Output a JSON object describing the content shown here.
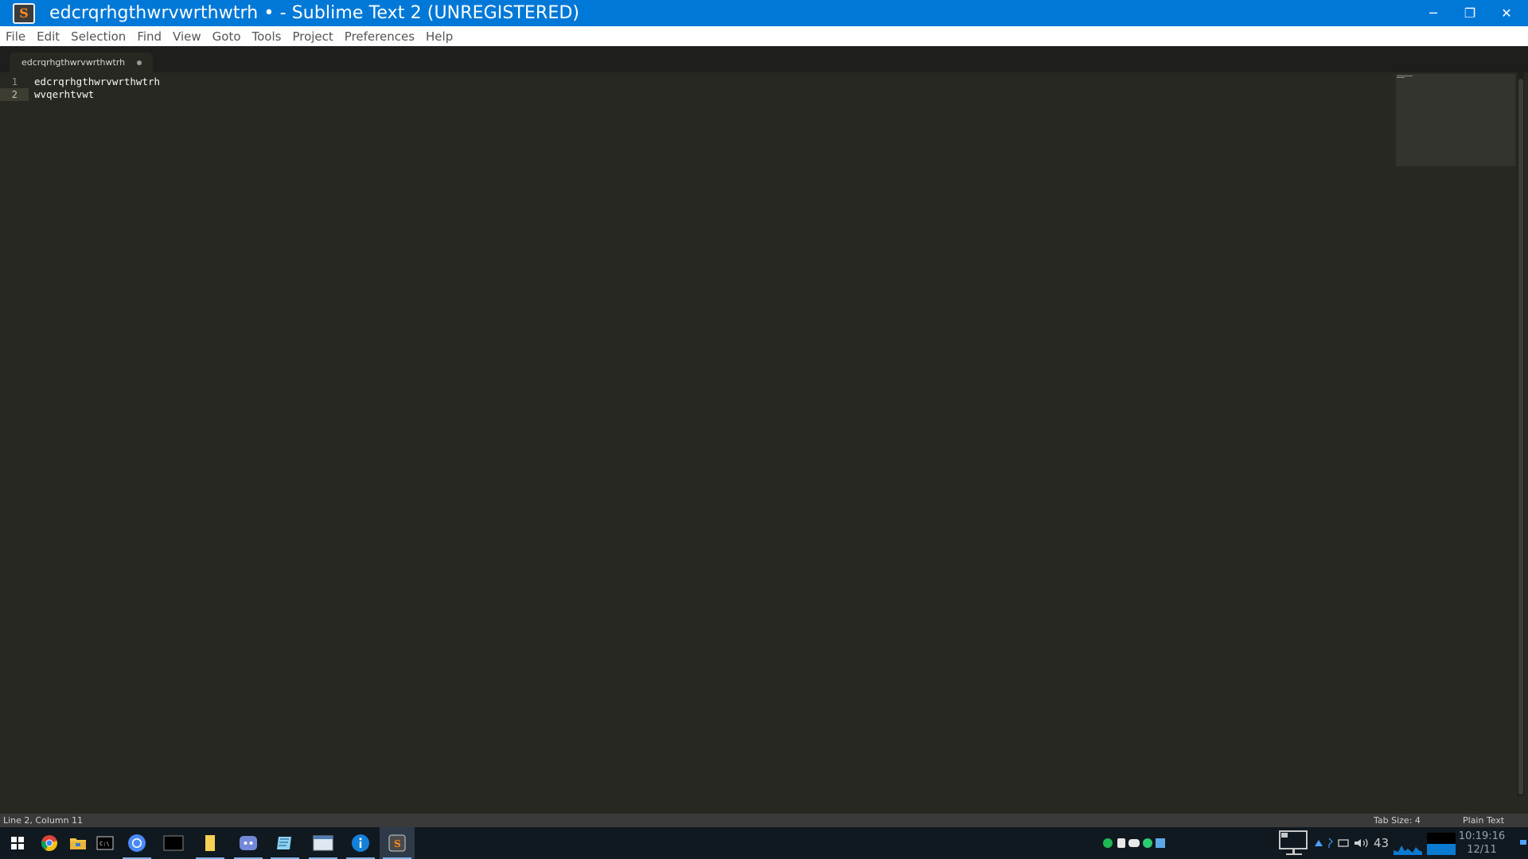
{
  "window": {
    "title": "edcrqrhgthwrvwrthwtrh • - Sublime Text 2 (UNREGISTERED)",
    "app_icon_letter": "S",
    "controls": {
      "minimize": "─",
      "restore": "❐",
      "close": "✕"
    }
  },
  "menu": {
    "items": [
      "File",
      "Edit",
      "Selection",
      "Find",
      "View",
      "Goto",
      "Tools",
      "Project",
      "Preferences",
      "Help"
    ]
  },
  "tabs": [
    {
      "label": "edcrqrhgthwrvwrthwtrh",
      "modified": true
    }
  ],
  "editor": {
    "line_numbers": [
      "1",
      "2"
    ],
    "lines": [
      "edcrqrhgthwrvwrthwtrh",
      "wvqerhtvwt"
    ],
    "active_line": 2
  },
  "status": {
    "position": "Line 2, Column 11",
    "tab_size": "Tab Size: 4",
    "syntax": "Plain Text"
  },
  "taskbar": {
    "apps": [
      "start-icon",
      "chrome-icon",
      "file-explorer-icon",
      "terminal-icon",
      "chromium-icon",
      "console-icon",
      "notes-icon",
      "discord-icon",
      "editor-icon",
      "window-icon",
      "info-icon",
      "sublime-text-icon"
    ],
    "tray_text": "43",
    "clock_time": "10:19:16",
    "clock_date": "12/11"
  },
  "colors": {
    "titlebar": "#0078d7",
    "editor_bg": "#272822",
    "text": "#f8f8f2",
    "taskbar": "#101820"
  }
}
